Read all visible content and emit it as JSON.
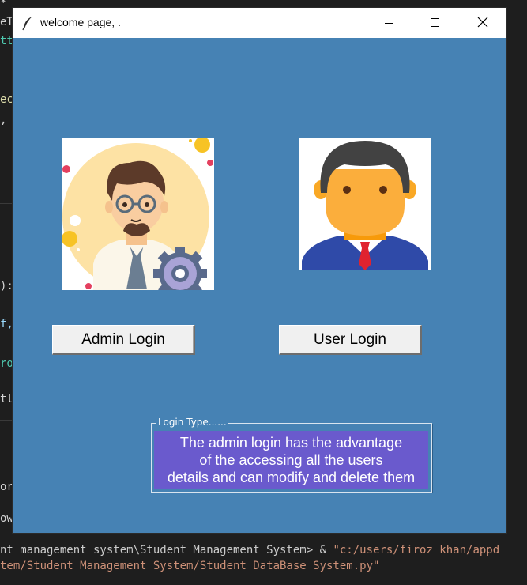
{
  "window": {
    "title": "welcome page,  ."
  },
  "buttons": {
    "admin_label": "Admin Login",
    "user_label": "User Login"
  },
  "login_type": {
    "frame_label": "Login Type......",
    "description_lines": [
      "The admin login has the  advantage",
      "of the accessing all the users",
      "details and can modify and delete them"
    ]
  },
  "background_editor": {
    "code_fragments": [
      "*",
      "eT",
      "tt",
      "ec",
      ",",
      "):",
      "f,",
      "ro",
      "tl",
      "or",
      "ow"
    ],
    "terminal": {
      "line1_plain": "nt management system\\Student Management System> & ",
      "line1_string": "\"c:/users/firoz khan/appd",
      "line2_string": "tem/Student Management System/Student_DataBase_System.py\""
    }
  },
  "colors": {
    "window_bg": "#4682b4",
    "info_bg": "#6a5acd",
    "button_bg": "#f0f0f0",
    "editor_bg": "#1e1e1e"
  },
  "icons": {
    "app": "feather-icon",
    "minimize": "minimize-icon",
    "maximize": "maximize-icon",
    "close": "close-icon",
    "admin_avatar": "admin-avatar-illustration",
    "user_avatar": "user-avatar-illustration"
  }
}
